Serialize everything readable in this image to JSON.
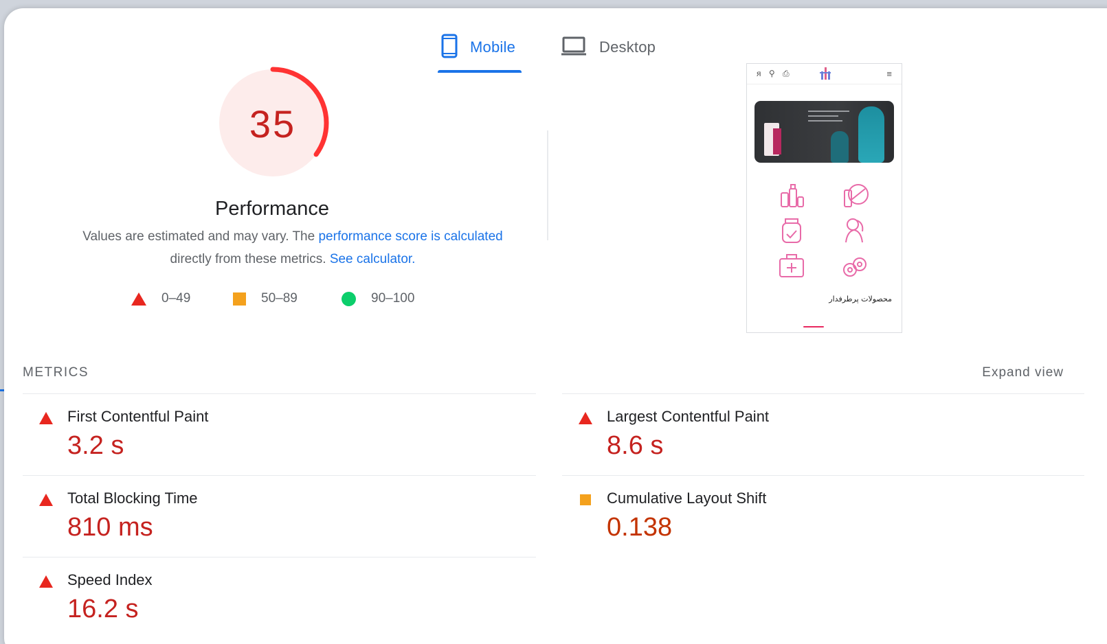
{
  "tabs": [
    {
      "label": "Mobile",
      "icon": "smartphone-icon",
      "active": true
    },
    {
      "label": "Desktop",
      "icon": "laptop-icon",
      "active": false
    }
  ],
  "gauge": {
    "score": "35",
    "score_fraction": 0.35,
    "label": "Performance",
    "color": "#ff3333",
    "bg": "#fdeceb"
  },
  "description": {
    "text_before": "Values are estimated and may vary. The ",
    "link1": "performance score is calculated",
    "text_middle": "directly from these metrics. ",
    "link2": "See calculator."
  },
  "legend": [
    {
      "range": "0–49",
      "icon": "triangle-fail-icon",
      "color": "#e8271f"
    },
    {
      "range": "50–89",
      "icon": "square-average-icon",
      "color": "#f4a11d"
    },
    {
      "range": "90–100",
      "icon": "circle-pass-icon",
      "color": "#0cce6b"
    }
  ],
  "preview": {
    "caption": "محصولات پرطرفدار",
    "icons_text": "ᴙ ⚲ ⎙",
    "menu": "≡"
  },
  "metrics": {
    "header": "METRICS",
    "expand_label": "Expand view",
    "items": [
      {
        "label": "First Contentful Paint",
        "value": "3.2 s",
        "status": "fail"
      },
      {
        "label": "Largest Contentful Paint",
        "value": "8.6 s",
        "status": "fail"
      },
      {
        "label": "Total Blocking Time",
        "value": "810 ms",
        "status": "fail"
      },
      {
        "label": "Cumulative Layout Shift",
        "value": "0.138",
        "status": "average"
      },
      {
        "label": "Speed Index",
        "value": "16.2 s",
        "status": "fail"
      }
    ]
  }
}
